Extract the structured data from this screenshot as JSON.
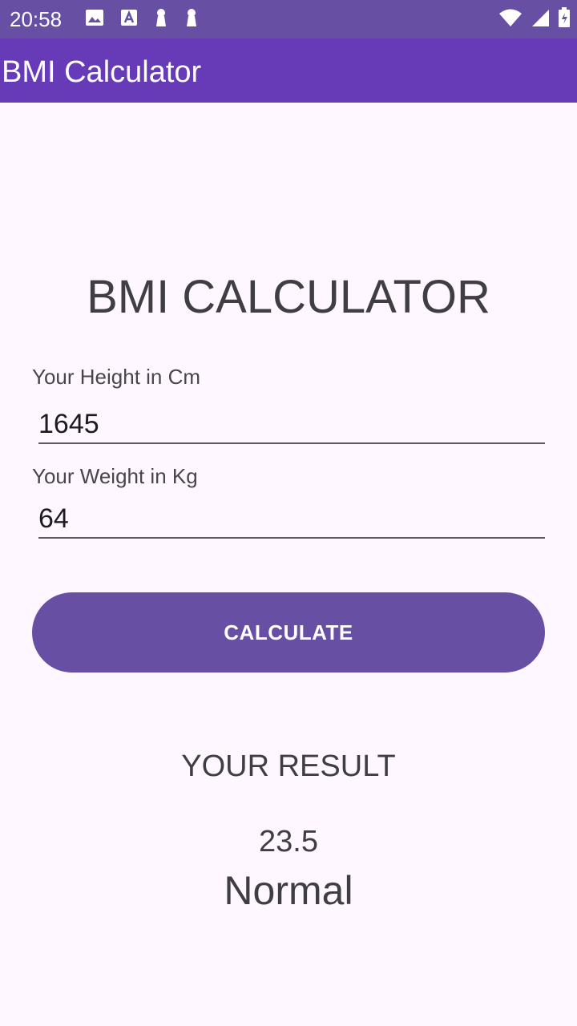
{
  "status_bar": {
    "time": "20:58",
    "icons_left": [
      "image-icon",
      "text-a-icon",
      "keyhole-icon",
      "keyhole-icon"
    ],
    "icons_right": [
      "wifi-icon",
      "signal-icon",
      "battery-icon"
    ]
  },
  "app_bar": {
    "title": "BMI Calculator"
  },
  "main": {
    "heading": "BMI CALCULATOR",
    "height_label": "Your Height in Cm",
    "height_value": "1645",
    "weight_label": "Your Weight in Kg",
    "weight_value": "64",
    "calculate_label": "CALCULATE"
  },
  "result": {
    "heading": "YOUR RESULT",
    "value": "23.5",
    "category": "Normal"
  },
  "colors": {
    "status_bar": "#6750a4",
    "app_bar": "#673ab7",
    "button": "#6750a4",
    "background": "#fef7ff"
  }
}
